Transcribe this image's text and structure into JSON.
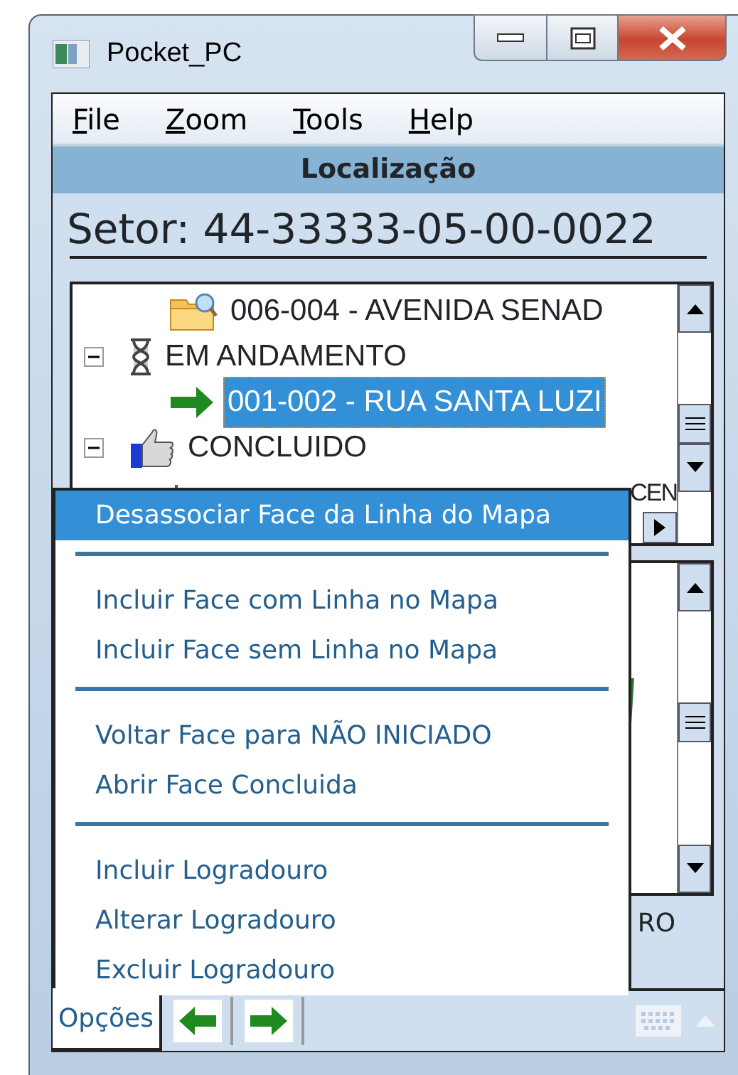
{
  "window": {
    "title": "Pocket_PC"
  },
  "menu": [
    {
      "mnemonic": "F",
      "rest": "ile"
    },
    {
      "mnemonic": "Z",
      "rest": "oom"
    },
    {
      "mnemonic": "T",
      "rest": "ools"
    },
    {
      "mnemonic": "H",
      "rest": "elp"
    }
  ],
  "header": "Localização",
  "sector": "Setor: 44-33333-05-00-0022",
  "tree": [
    {
      "children": [
        {
          "kind": "folder",
          "label": "006-004 - AVENIDA SENAD",
          "selected": false
        }
      ]
    },
    {
      "kind": "hourglass",
      "label": "EM ANDAMENTO",
      "expanded": true,
      "selected": false,
      "children": [
        {
          "kind": "arrow",
          "label": "001-002 - RUA SANTA LUZI",
          "selected": true
        }
      ]
    },
    {
      "kind": "thumb",
      "label": "CONCLUIDO",
      "expanded": true,
      "selected": false,
      "children": [
        {
          "kind": "pin",
          "label": "CEN",
          "selected": false
        }
      ]
    }
  ],
  "lower_panel": {
    "label": "RO"
  },
  "popup_menu": [
    {
      "kind": "item",
      "label": "Desassociar Face da Linha do Mapa",
      "selected": true
    },
    {
      "kind": "separator"
    },
    {
      "kind": "item",
      "label": "Incluir Face com Linha no Mapa",
      "selected": false
    },
    {
      "kind": "item",
      "label": "Incluir Face sem Linha no Mapa",
      "selected": false
    },
    {
      "kind": "separator"
    },
    {
      "kind": "item",
      "label": "Voltar Face para NÃO INICIADO",
      "selected": false
    },
    {
      "kind": "item",
      "label": "Abrir Face Concluida",
      "selected": false
    },
    {
      "kind": "separator"
    },
    {
      "kind": "item",
      "label": "Incluir Logradouro",
      "selected": false
    },
    {
      "kind": "item",
      "label": "Alterar Logradouro",
      "selected": false
    },
    {
      "kind": "item",
      "label": "Excluir Logradouro",
      "selected": false
    }
  ],
  "toolbar": {
    "tab": {
      "label": "Opções",
      "selected": true
    }
  }
}
